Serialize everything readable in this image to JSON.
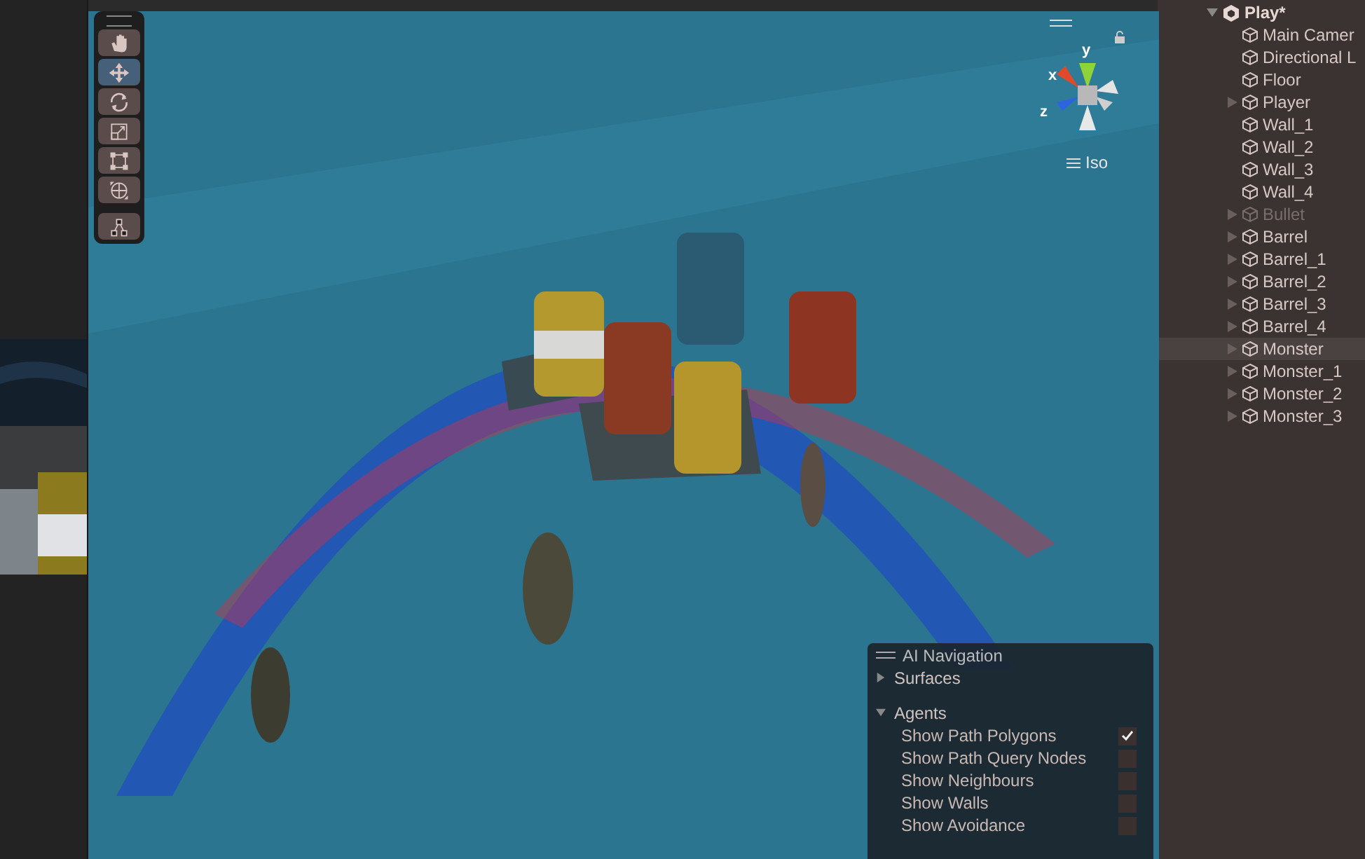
{
  "hierarchy": {
    "scene": {
      "label": "Play*",
      "expanded": true
    },
    "items": [
      {
        "label": "Main Camer",
        "has_children": false,
        "disabled": false,
        "selected": false
      },
      {
        "label": "Directional L",
        "has_children": false,
        "disabled": false,
        "selected": false
      },
      {
        "label": "Floor",
        "has_children": false,
        "disabled": false,
        "selected": false
      },
      {
        "label": "Player",
        "has_children": true,
        "disabled": false,
        "selected": false
      },
      {
        "label": "Wall_1",
        "has_children": false,
        "disabled": false,
        "selected": false
      },
      {
        "label": "Wall_2",
        "has_children": false,
        "disabled": false,
        "selected": false
      },
      {
        "label": "Wall_3",
        "has_children": false,
        "disabled": false,
        "selected": false
      },
      {
        "label": "Wall_4",
        "has_children": false,
        "disabled": false,
        "selected": false
      },
      {
        "label": "Bullet",
        "has_children": true,
        "disabled": true,
        "selected": false
      },
      {
        "label": "Barrel",
        "has_children": true,
        "disabled": false,
        "selected": false
      },
      {
        "label": "Barrel_1",
        "has_children": true,
        "disabled": false,
        "selected": false
      },
      {
        "label": "Barrel_2",
        "has_children": true,
        "disabled": false,
        "selected": false
      },
      {
        "label": "Barrel_3",
        "has_children": true,
        "disabled": false,
        "selected": false
      },
      {
        "label": "Barrel_4",
        "has_children": true,
        "disabled": false,
        "selected": false
      },
      {
        "label": "Monster",
        "has_children": true,
        "disabled": false,
        "selected": true
      },
      {
        "label": "Monster_1",
        "has_children": true,
        "disabled": false,
        "selected": false
      },
      {
        "label": "Monster_2",
        "has_children": true,
        "disabled": false,
        "selected": false
      },
      {
        "label": "Monster_3",
        "has_children": true,
        "disabled": false,
        "selected": false
      }
    ]
  },
  "scene_view": {
    "tools": [
      {
        "kind": "hand",
        "selected": false
      },
      {
        "kind": "move",
        "selected": true
      },
      {
        "kind": "rotate",
        "selected": false
      },
      {
        "kind": "scale",
        "selected": false
      },
      {
        "kind": "rect",
        "selected": false
      },
      {
        "kind": "transform",
        "selected": false
      },
      {
        "kind": "custom",
        "selected": false
      }
    ],
    "gizmo": {
      "x": "x",
      "y": "y",
      "z": "z",
      "projection": "Iso"
    },
    "ai_navigation": {
      "title": "AI Navigation",
      "sections": [
        {
          "label": "Surfaces",
          "expanded": false
        },
        {
          "label": "Agents",
          "expanded": true,
          "options": [
            {
              "label": "Show Path Polygons",
              "checked": true
            },
            {
              "label": "Show Path Query Nodes",
              "checked": false
            },
            {
              "label": "Show Neighbours",
              "checked": false
            },
            {
              "label": "Show Walls",
              "checked": false
            },
            {
              "label": "Show Avoidance",
              "checked": false
            }
          ]
        }
      ]
    }
  }
}
